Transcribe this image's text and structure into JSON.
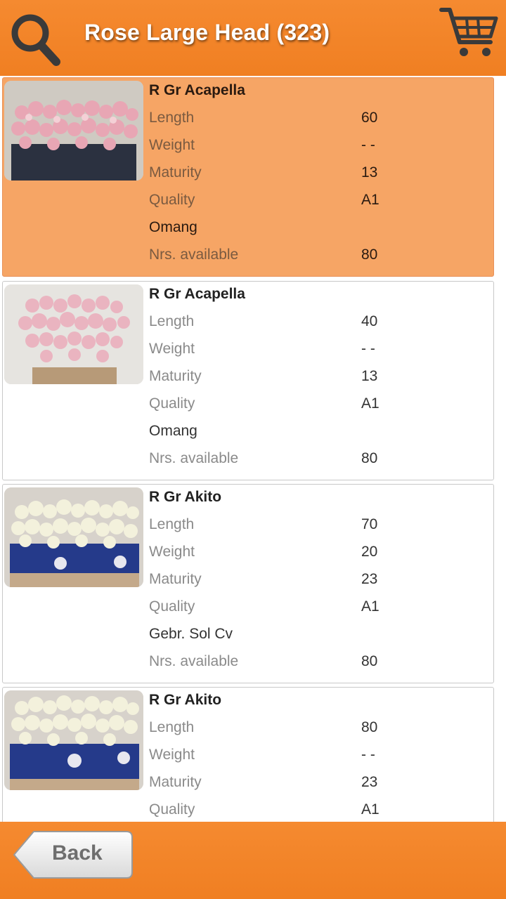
{
  "header": {
    "title": "Rose Large Head (323)"
  },
  "labels": {
    "length": "Length",
    "weight": "Weight",
    "maturity": "Maturity",
    "quality": "Quality",
    "available": "Nrs. available"
  },
  "items": [
    {
      "name": "R Gr Acapella",
      "length": "60",
      "weight": "- -",
      "maturity": "13",
      "quality": "A1",
      "grower": "Omang",
      "available": "80"
    },
    {
      "name": "R Gr Acapella",
      "length": "40",
      "weight": "- -",
      "maturity": "13",
      "quality": "A1",
      "grower": "Omang",
      "available": "80"
    },
    {
      "name": "R Gr Akito",
      "length": "70",
      "weight": "20",
      "maturity": "23",
      "quality": "A1",
      "grower": "Gebr. Sol Cv",
      "available": "80"
    },
    {
      "name": "R Gr Akito",
      "length": "80",
      "weight": "- -",
      "maturity": "23",
      "quality": "A1"
    }
  ],
  "footer": {
    "back_label": "Back"
  },
  "colors": {
    "accent": "#f58a30",
    "selected_row": "#f6a565"
  }
}
